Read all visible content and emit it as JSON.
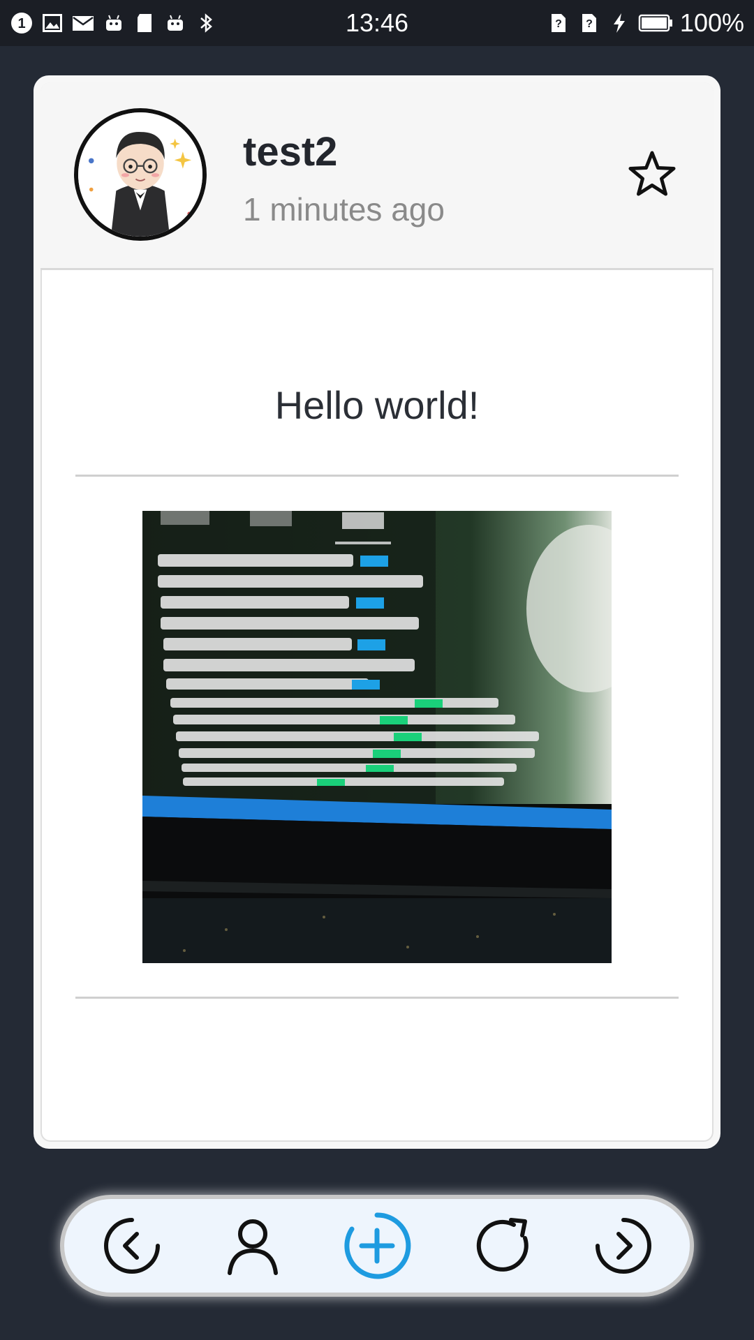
{
  "status_bar": {
    "time": "13:46",
    "battery": "100%",
    "icons_left": [
      "notification-count-icon",
      "gallery-icon",
      "mail-icon",
      "android-icon",
      "sd-card-icon",
      "android-icon",
      "bluetooth-icon"
    ],
    "icons_right": [
      "sim-unknown-icon",
      "sim-unknown-icon",
      "charging-icon",
      "battery-icon"
    ]
  },
  "post": {
    "username": "test2",
    "timestamp": "1 minutes ago",
    "text": "Hello world!",
    "favorite_icon": "star-outline-icon",
    "image_icon": "terminal-photo"
  },
  "nav": {
    "items": [
      {
        "name": "prev",
        "icon": "chevron-left-circle-icon"
      },
      {
        "name": "user",
        "icon": "user-icon"
      },
      {
        "name": "add",
        "icon": "plus-circle-icon",
        "color": "#1e9be0"
      },
      {
        "name": "refresh",
        "icon": "refresh-icon"
      },
      {
        "name": "next",
        "icon": "chevron-right-circle-icon"
      }
    ]
  },
  "colors": {
    "background": "#242a35",
    "status_bar": "#1b1e25",
    "accent": "#1e9be0",
    "nav_bg": "#eef5fd"
  }
}
